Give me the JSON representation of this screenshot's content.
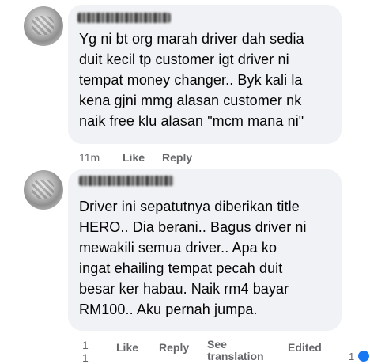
{
  "comments": [
    {
      "text": "Yg ni bt org marah driver dah sedia\nduit kecil tp customer igt driver ni\ntempat money changer.. Byk kali la\nkena gjni mmg alasan customer nk\nnaik free klu alasan \"mcm mana ni\"",
      "time": "11m",
      "like": "Like",
      "reply": "Reply"
    },
    {
      "text": "Driver ini sepatutnya diberikan title\nHERO.. Dia berani.. Bagus driver ni\nmewakili semua driver.. Apa ko\ningat ehailing tempat pecah duit\nbesar ker habau. Naik rm4 bayar\nRM100.. Aku pernah jumpa.",
      "time": "1\n1",
      "like": "Like",
      "reply": "Reply",
      "see_translation": "See\ntranslation",
      "edited": "Edited",
      "reaction_count": "1"
    }
  ],
  "colors": {
    "bubble": "#f0f2f5",
    "meta": "#65676b",
    "reaction": "#1877f2"
  }
}
